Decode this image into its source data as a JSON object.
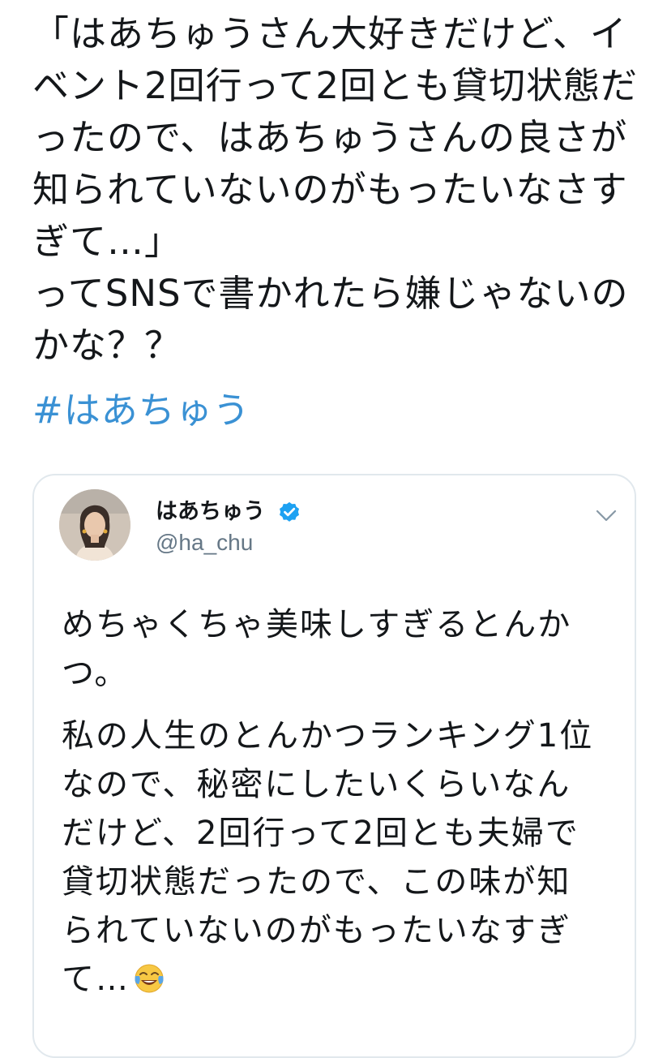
{
  "tweet": {
    "text_lines": [
      "「はあちゅうさん大好きだけど、イ",
      "ベント2回行って2回とも貸切状態だ",
      "ったので、はあちゅうさんの良さが",
      "知られていないのがもったいなさす",
      "ぎて…」",
      "ってSNSで書かれたら嫌じゃないの",
      "かな？？"
    ],
    "hashtag": "#はあちゅう"
  },
  "quoted_tweet": {
    "author_name": "はあちゅう",
    "author_handle": "@ha_chu",
    "verified_icon": "verified-badge-icon",
    "menu_icon": "chevron-down-icon",
    "paragraphs": [
      {
        "lines": [
          "めちゃくちゃ美味しすぎるとんか",
          "つ。"
        ]
      },
      {
        "lines": [
          "私の人生のとんかつランキング1位",
          "なので、秘密にしたいくらいなん",
          "だけど、2回行って2回とも夫婦で",
          "貸切状態だったので、この味が知",
          "られていないのがもったいなすぎ",
          "て…"
        ],
        "trailing_emoji": "face-with-tears-of-joy-icon"
      }
    ]
  },
  "colors": {
    "text": "#14171a",
    "hashtag": "#3a91d4",
    "handle": "#657786",
    "card_border": "#e1e8ed",
    "verified": "#1da1f2"
  }
}
